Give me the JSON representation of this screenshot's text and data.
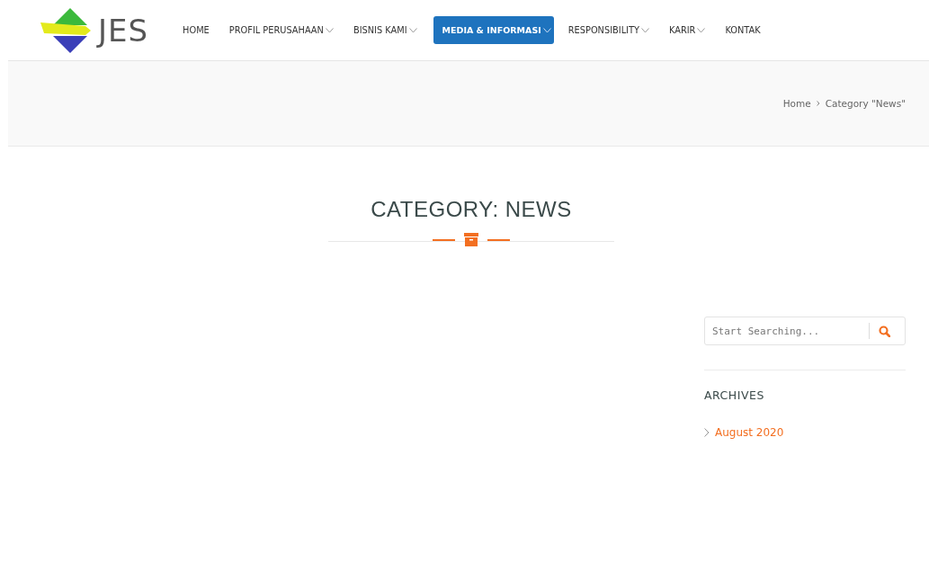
{
  "logo": {
    "text": "JES"
  },
  "nav": [
    {
      "label": "HOME",
      "selected": false,
      "has_menu": false
    },
    {
      "label": "PROFIL PERUSAHAAN",
      "selected": false,
      "has_menu": true
    },
    {
      "label": "BISNIS KAMI",
      "selected": false,
      "has_menu": true
    },
    {
      "label": "MEDIA & INFORMASI",
      "selected": true,
      "has_menu": true
    },
    {
      "label": "RESPONSIBILITY",
      "selected": false,
      "has_menu": true
    },
    {
      "label": "KARIR",
      "selected": false,
      "has_menu": true
    },
    {
      "label": "KONTAK",
      "selected": false,
      "has_menu": false
    }
  ],
  "breadcrumb": [
    {
      "label": "Home"
    },
    {
      "label": "Category \"News\""
    }
  ],
  "page_title": "CATEGORY: NEWS",
  "sidebar": {
    "search": {
      "placeholder": "Start Searching..."
    },
    "archives": {
      "title": "ARCHIVES",
      "items": [
        {
          "label": "August 2020"
        }
      ]
    }
  }
}
